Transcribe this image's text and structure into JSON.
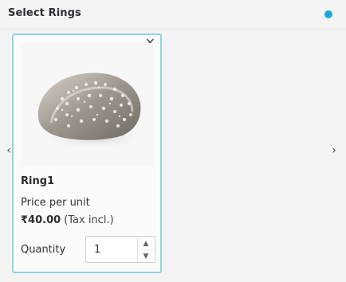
{
  "panel": {
    "title": "Select Rings",
    "info_color": "#1ea7d9"
  },
  "navigation": {
    "prev_icon": "‹",
    "next_icon": "›"
  },
  "card": {
    "close_icon": "✕",
    "name": "Ring1",
    "price_label": "Price per unit",
    "price": "₹40.00",
    "tax_note": "(Tax incl.)",
    "quantity_label": "Quantity",
    "quantity_value": "1",
    "border_color": "#8fd3e2"
  },
  "stepper": {
    "up_icon": "▲",
    "down_icon": "▼"
  }
}
